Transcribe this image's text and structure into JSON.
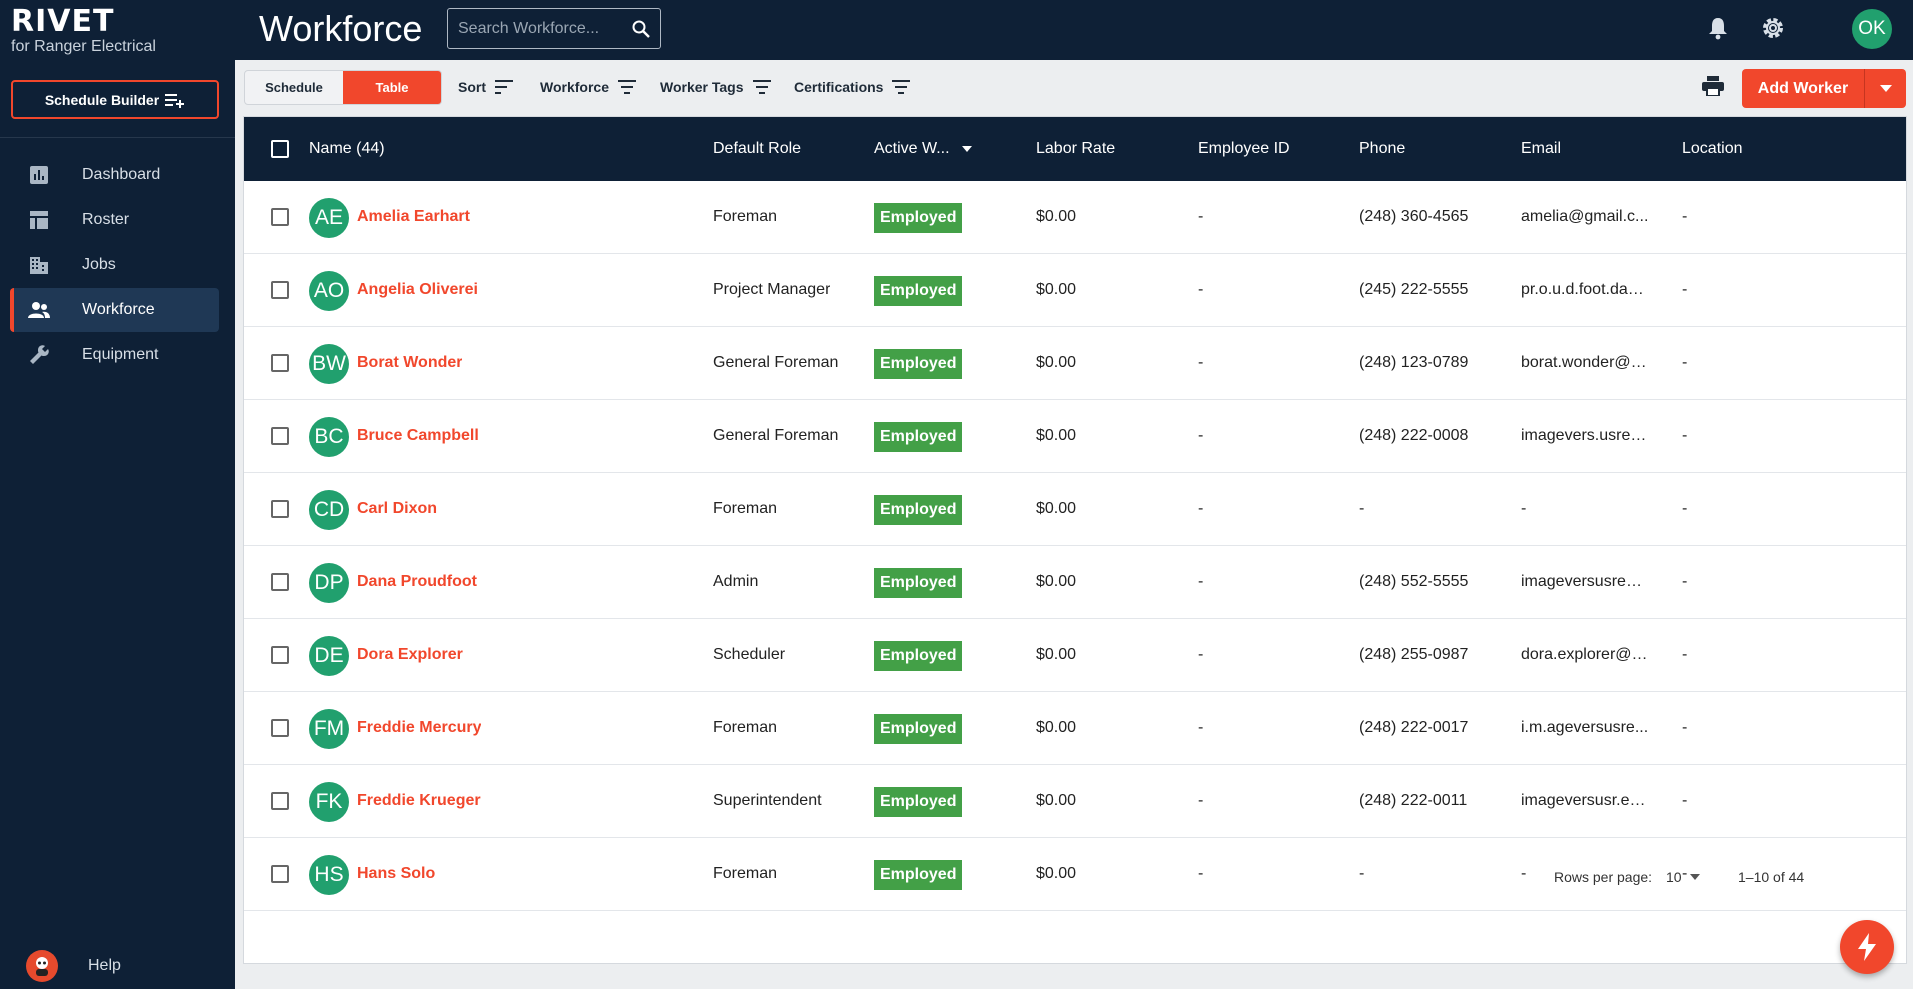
{
  "brand": {
    "name": "RIVET",
    "subtitle": "for Ranger Electrical"
  },
  "sidebar": {
    "schedule_builder_label": "Schedule Builder",
    "items": [
      {
        "label": "Dashboard",
        "icon": "dashboard-icon"
      },
      {
        "label": "Roster",
        "icon": "roster-icon"
      },
      {
        "label": "Jobs",
        "icon": "jobs-icon"
      },
      {
        "label": "Workforce",
        "icon": "workforce-icon",
        "active": true
      },
      {
        "label": "Equipment",
        "icon": "wrench-icon"
      }
    ],
    "help_label": "Help"
  },
  "header": {
    "title": "Workforce",
    "search_placeholder": "Search Workforce...",
    "avatar_initials": "OK"
  },
  "toolbar": {
    "view_schedule": "Schedule",
    "view_table": "Table",
    "sort": "Sort",
    "workforce": "Workforce",
    "worker_tags": "Worker Tags",
    "certifications": "Certifications",
    "add_worker": "Add Worker"
  },
  "table": {
    "columns": {
      "name": "Name (44)",
      "default_role": "Default Role",
      "active": "Active W...",
      "labor_rate": "Labor Rate",
      "employee_id": "Employee ID",
      "phone": "Phone",
      "email": "Email",
      "location": "Location"
    },
    "rows": [
      {
        "initials": "AE",
        "name": "Amelia Earhart",
        "role": "Foreman",
        "status": "Employed",
        "rate": "$0.00",
        "emp_id": "-",
        "phone": "(248) 360-4565",
        "email": "amelia@gmail.c...",
        "location": "-"
      },
      {
        "initials": "AO",
        "name": "Angelia Oliverei",
        "role": "Project Manager",
        "status": "Employed",
        "rate": "$0.00",
        "emp_id": "-",
        "phone": "(245) 222-5555",
        "email": "pr.o.u.d.foot.dan...",
        "location": "-"
      },
      {
        "initials": "BW",
        "name": "Borat Wonder",
        "role": "General Foreman",
        "status": "Employed",
        "rate": "$0.00",
        "emp_id": "-",
        "phone": "(248) 123-0789",
        "email": "borat.wonder@g...",
        "location": "-"
      },
      {
        "initials": "BC",
        "name": "Bruce Campbell",
        "role": "General Foreman",
        "status": "Employed",
        "rate": "$0.00",
        "emp_id": "-",
        "phone": "(248) 222-0008",
        "email": "imagevers.usrea...",
        "location": "-"
      },
      {
        "initials": "CD",
        "name": "Carl Dixon",
        "role": "Foreman",
        "status": "Employed",
        "rate": "$0.00",
        "emp_id": "-",
        "phone": "-",
        "email": "-",
        "location": "-"
      },
      {
        "initials": "DP",
        "name": "Dana Proudfoot",
        "role": "Admin",
        "status": "Employed",
        "rate": "$0.00",
        "emp_id": "-",
        "phone": "(248) 552-5555",
        "email": "imageversusreal...",
        "location": "-"
      },
      {
        "initials": "DE",
        "name": "Dora Explorer",
        "role": "Scheduler",
        "status": "Employed",
        "rate": "$0.00",
        "emp_id": "-",
        "phone": "(248) 255-0987",
        "email": "dora.explorer@g...",
        "location": "-"
      },
      {
        "initials": "FM",
        "name": "Freddie Mercury",
        "role": "Foreman",
        "status": "Employed",
        "rate": "$0.00",
        "emp_id": "-",
        "phone": "(248) 222-0017",
        "email": "i.m.ageversusre...",
        "location": "-"
      },
      {
        "initials": "FK",
        "name": "Freddie Krueger",
        "role": "Superintendent",
        "status": "Employed",
        "rate": "$0.00",
        "emp_id": "-",
        "phone": "(248) 222-0011",
        "email": "imageversusr.ea...",
        "location": "-"
      },
      {
        "initials": "HS",
        "name": "Hans Solo",
        "role": "Foreman",
        "status": "Employed",
        "rate": "$0.00",
        "emp_id": "-",
        "phone": "-",
        "email": "-",
        "location": "-"
      }
    ]
  },
  "pagination": {
    "rows_per_page_label": "Rows per page:",
    "rows_per_page": "10",
    "range": "1–10 of 44"
  },
  "colors": {
    "accent": "#f1472c",
    "navy": "#0e2036",
    "success": "#43a047",
    "avatar": "#21a06e"
  }
}
